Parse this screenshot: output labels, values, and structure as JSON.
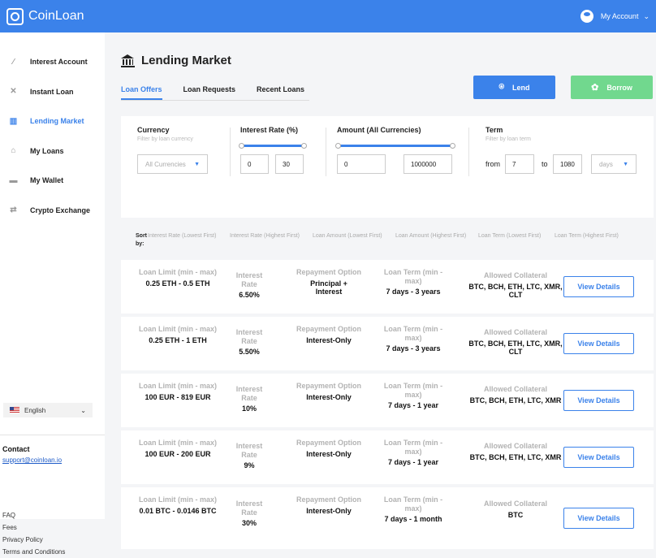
{
  "app": {
    "name": "CoinLoan",
    "account_label": "My Account"
  },
  "sidebar": {
    "items": [
      {
        "label": "Interest Account",
        "icon": "percent-icon",
        "glyph": "⁄"
      },
      {
        "label": "Instant Loan",
        "icon": "instant-loan-icon",
        "glyph": "✕"
      },
      {
        "label": "Lending Market",
        "icon": "bank-icon",
        "glyph": "▥"
      },
      {
        "label": "My Loans",
        "icon": "loans-icon",
        "glyph": "⌂"
      },
      {
        "label": "My Wallet",
        "icon": "wallet-icon",
        "glyph": "▬"
      },
      {
        "label": "Crypto Exchange",
        "icon": "exchange-icon",
        "glyph": "⇄"
      }
    ],
    "active_index": 2,
    "language": "English",
    "contact_title": "Contact",
    "contact_email": "support@coinloan.io",
    "links": [
      "FAQ",
      "Fees",
      "Privacy Policy",
      "Terms and Conditions"
    ]
  },
  "page": {
    "title": "Lending Market",
    "tabs": [
      "Loan Offers",
      "Loan Requests",
      "Recent Loans"
    ],
    "active_tab": 0,
    "lend_label": "Lend",
    "borrow_label": "Borrow"
  },
  "filters": {
    "currency": {
      "label": "Currency",
      "sub": "Filter by loan currency",
      "value": "All Currencies"
    },
    "interest": {
      "label": "Interest Rate (%)",
      "min": "0",
      "max": "30"
    },
    "amount": {
      "label": "Amount (All Currencies)",
      "min": "0",
      "max": "1000000"
    },
    "term": {
      "label": "Term",
      "sub": "Filter by loan term",
      "from_label": "from",
      "from": "7",
      "to_label": "to",
      "to": "1080",
      "unit": "days"
    }
  },
  "sort": {
    "label": "Sort by:",
    "options": [
      "Interest Rate (Lowest First)",
      "Interest Rate (Highest First)",
      "Loan Amount (Lowest First)",
      "Loan Amount (Highest First)",
      "Loan Term (Lowest First)",
      "Loan Term (Highest First)"
    ]
  },
  "columns": {
    "limit": "Loan Limit (min - max)",
    "rate": "Interest Rate",
    "repay": "Repayment Option",
    "term": "Loan Term (min - max)",
    "collateral": "Allowed Collateral",
    "action": "View Details"
  },
  "offers": [
    {
      "limit": "0.25 ETH - 0.5 ETH",
      "rate": "6.50%",
      "repay": "Principal + Interest",
      "term": "7 days - 3 years",
      "collateral": "BTC, BCH, ETH, LTC, XMR, CLT"
    },
    {
      "limit": "0.25 ETH - 1 ETH",
      "rate": "5.50%",
      "repay": "Interest-Only",
      "term": "7 days - 3 years",
      "collateral": "BTC, BCH, ETH, LTC, XMR, CLT"
    },
    {
      "limit": "100 EUR - 819 EUR",
      "rate": "10%",
      "repay": "Interest-Only",
      "term": "7 days - 1 year",
      "collateral": "BTC, BCH, ETH, LTC, XMR"
    },
    {
      "limit": "100 EUR - 200 EUR",
      "rate": "9%",
      "repay": "Interest-Only",
      "term": "7 days - 1 year",
      "collateral": "BTC, BCH, ETH, LTC, XMR"
    },
    {
      "limit": "0.01 BTC - 0.0146 BTC",
      "rate": "30%",
      "repay": "Interest-Only",
      "term": "7 days - 1 month",
      "collateral": "BTC"
    }
  ],
  "colors": {
    "accent": "#3b82ea",
    "borrow": "#71d88e"
  }
}
